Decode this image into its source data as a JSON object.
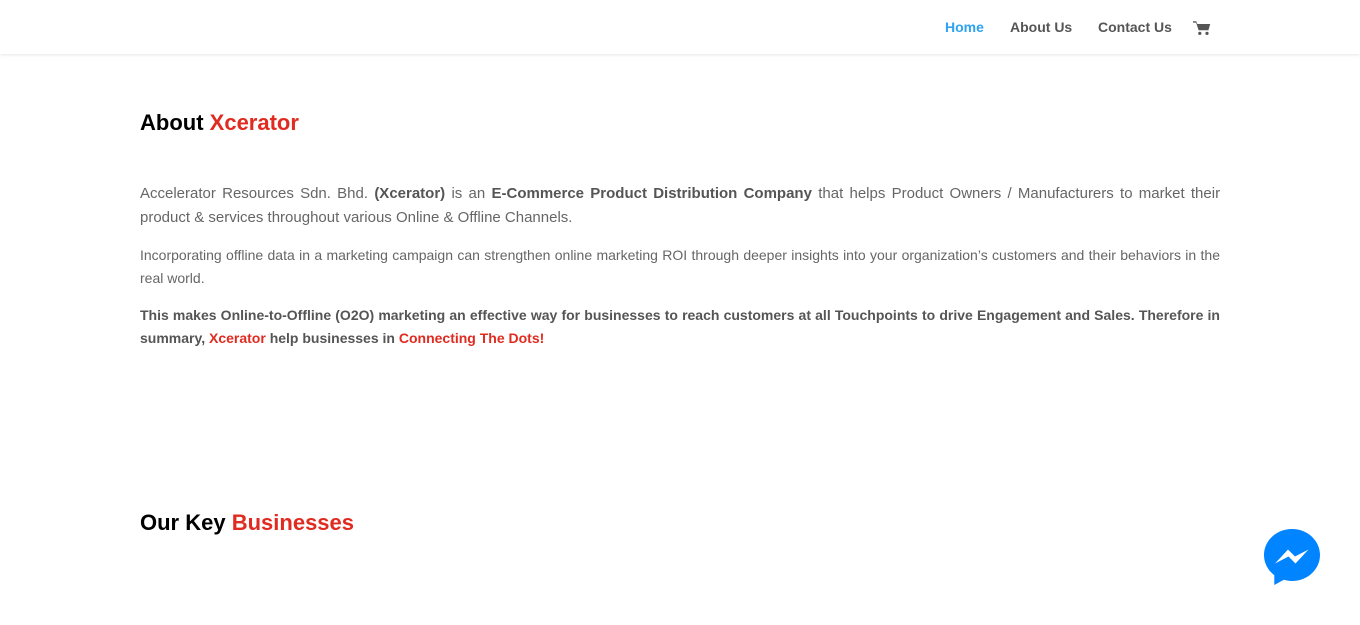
{
  "nav": {
    "items": [
      {
        "label": "Home",
        "active": true
      },
      {
        "label": "About Us",
        "active": false
      },
      {
        "label": "Contact Us",
        "active": false
      }
    ],
    "cart_icon": "cart-icon"
  },
  "about": {
    "heading_prefix": "About",
    "heading_highlight": "Xcerator",
    "p1_a": "Accelerator Resources Sdn. Bhd.",
    "p1_b": "(Xcerator)",
    "p1_c": "is an",
    "p1_d": "E-Commerce Product Distribution Company",
    "p1_e": "that helps Product Owners / Manufacturers to market their product & services throughout various Online & Offline Channels.",
    "p2": "Incorporating offline data in a marketing campaign can strengthen online marketing ROI through deeper insights into your organization’s customers and their behaviors in the real world.",
    "p3_a": "This makes Online-to-Offline (O2O) marketing an effective way for businesses to reach customers at all Touchpoints to drive Engagement and Sales. Therefore in summary,",
    "p3_b": "Xcerator",
    "p3_c": "help businesses in",
    "p3_d": "Connecting The Dots!"
  },
  "businesses": {
    "heading_prefix": "Our Key",
    "heading_highlight": "Businesses"
  },
  "messenger": {
    "icon": "messenger-icon"
  },
  "colors": {
    "accent_red": "#e02b20",
    "nav_active": "#2ea3f2",
    "messenger_blue": "#0084ff"
  }
}
